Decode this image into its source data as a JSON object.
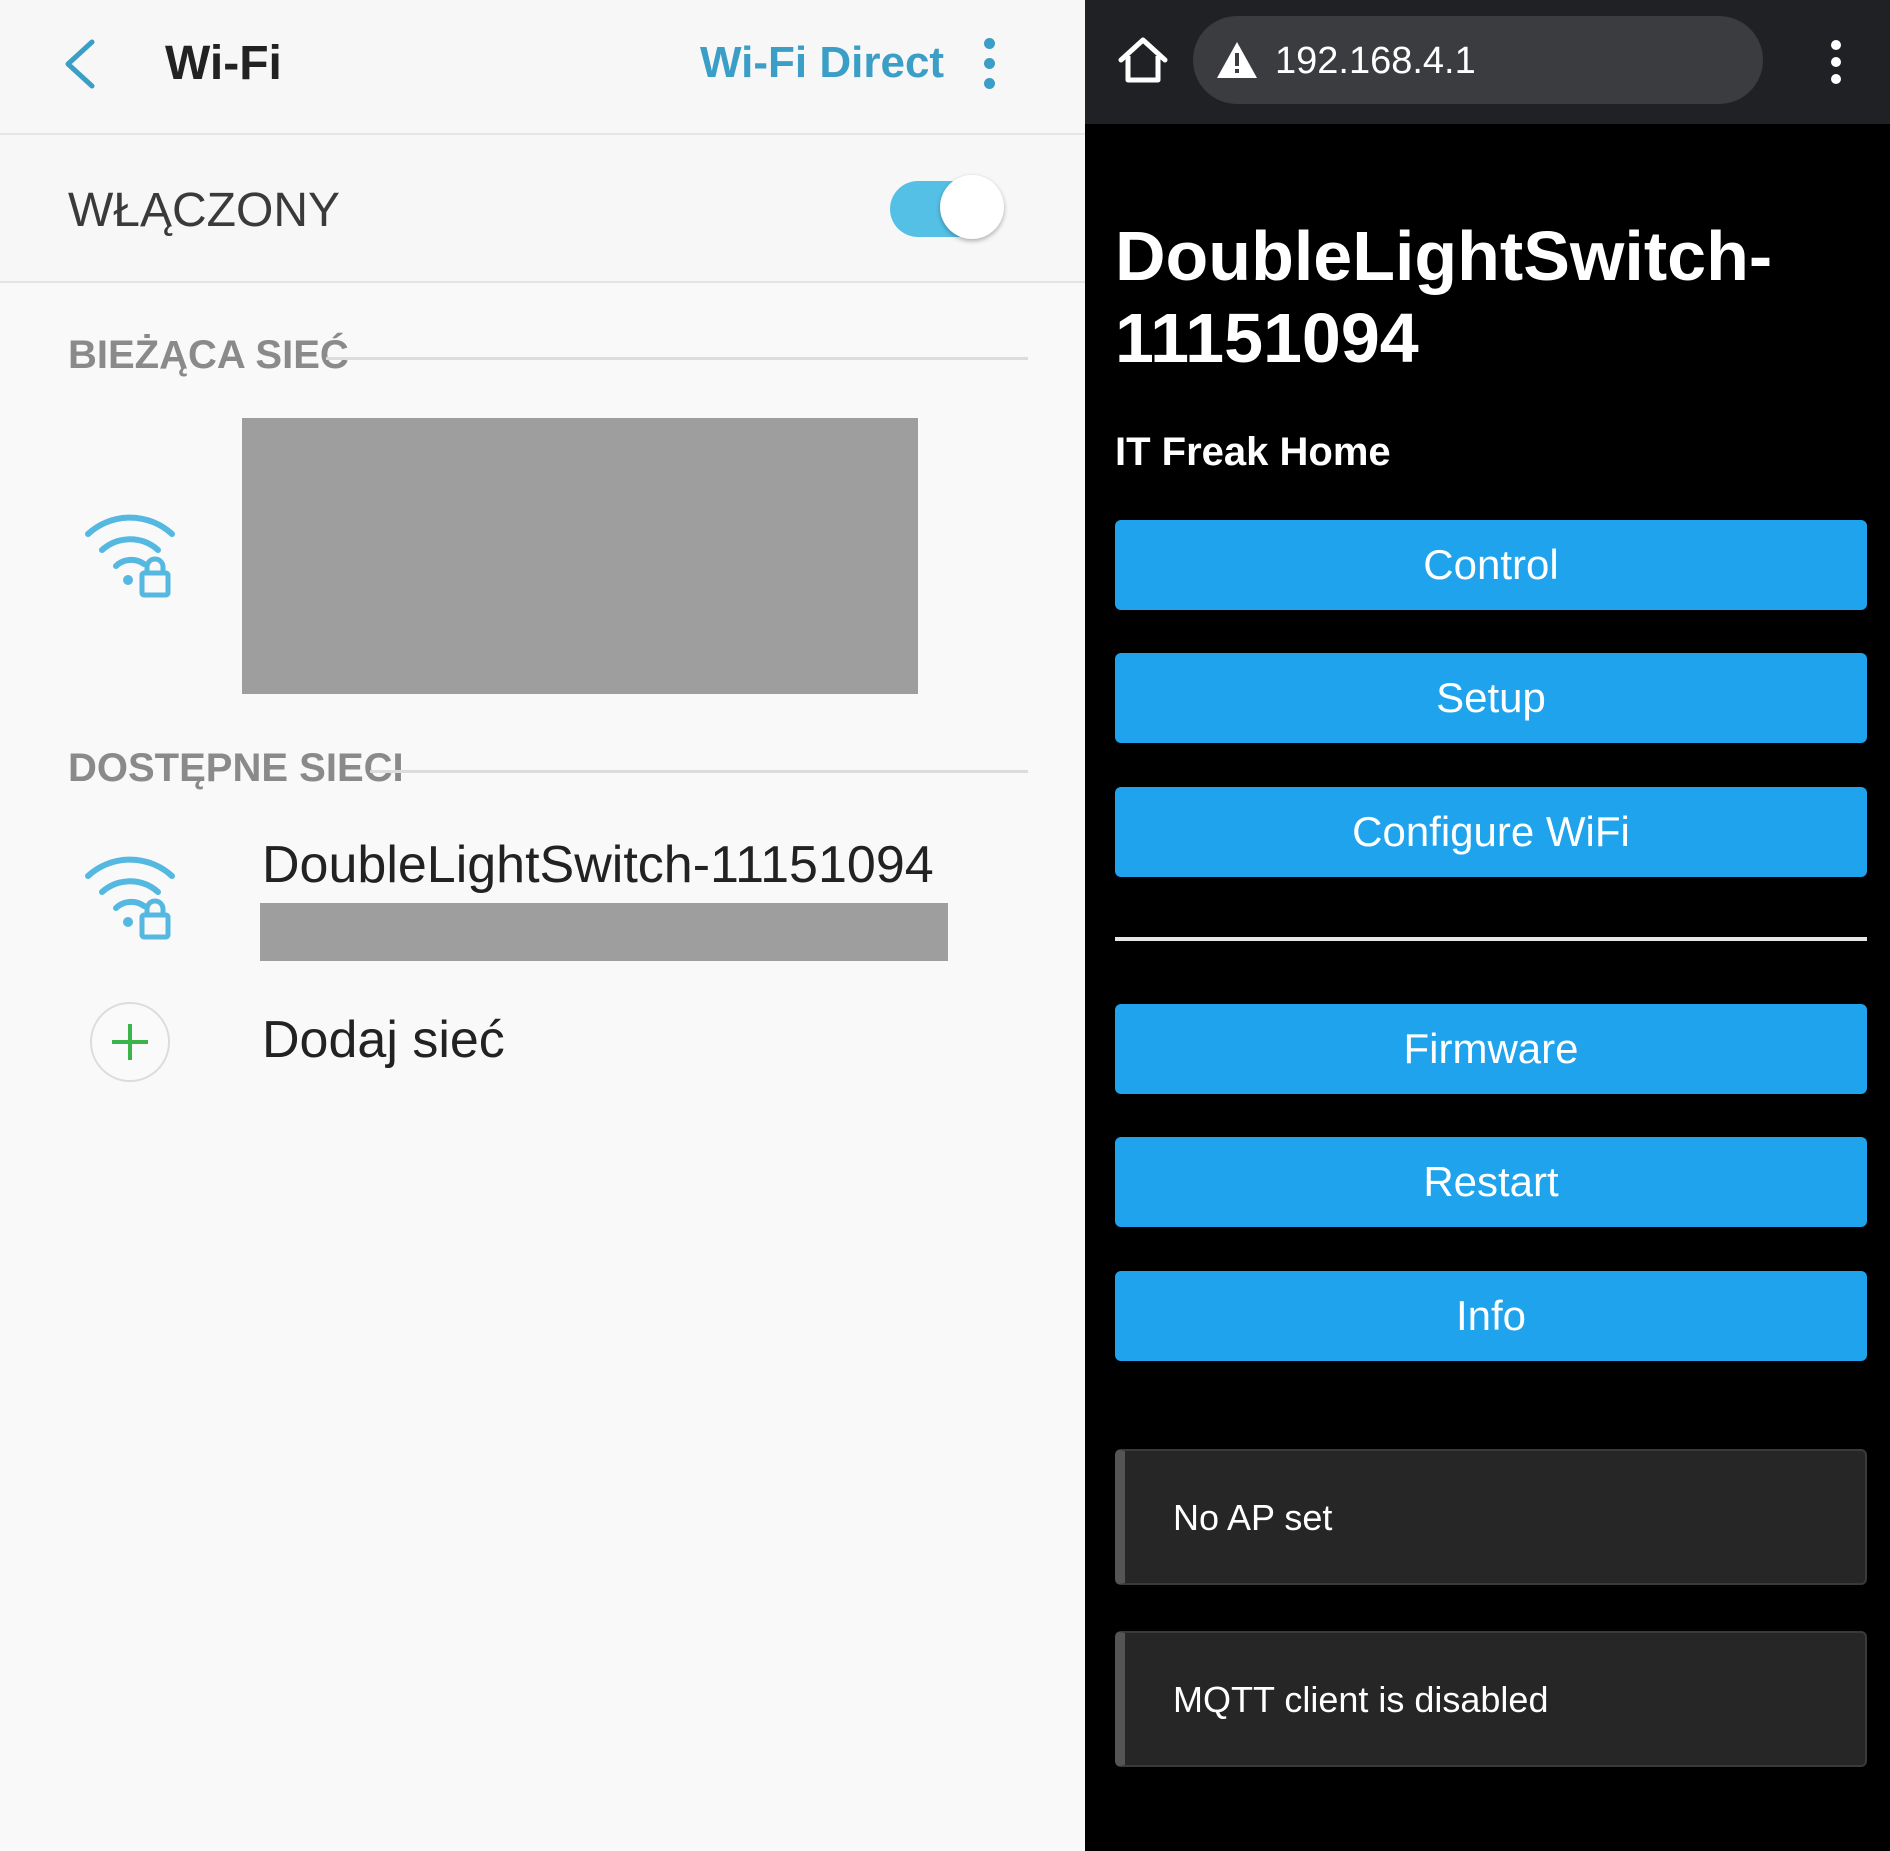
{
  "settings": {
    "title": "Wi-Fi",
    "wifi_direct": "Wi-Fi Direct",
    "toggle_label": "WŁĄCZONY",
    "toggle_on": true,
    "current_header": "BIEŻĄCA SIEĆ",
    "available_header": "DOSTĘPNE SIECI",
    "network_name": "DoubleLightSwitch-11151094",
    "add_network": "Dodaj sieć",
    "icons": [
      "back-arrow-icon",
      "more-vert-icon",
      "wifi-lock-icon",
      "plus-icon"
    ],
    "accent_color": "#3b9ec6"
  },
  "browser": {
    "url": "192.168.4.1",
    "icons": [
      "home-icon",
      "warning-icon",
      "more-vert-icon"
    ]
  },
  "page": {
    "title": "DoubleLightSwitch-11151094",
    "subtitle": "IT Freak Home",
    "buttons_top": [
      "Control",
      "Setup",
      "Configure WiFi"
    ],
    "buttons_bottom": [
      "Firmware",
      "Restart",
      "Info"
    ],
    "messages": [
      "No AP set",
      "MQTT client is disabled"
    ],
    "button_color": "#1fa3ec"
  }
}
